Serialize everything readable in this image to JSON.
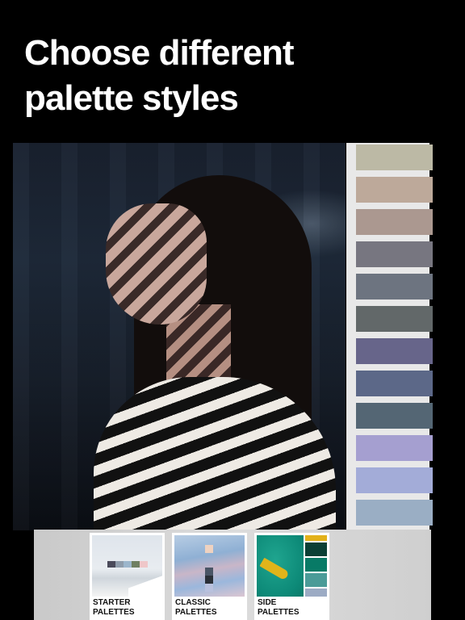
{
  "headline": {
    "line1": "Choose different",
    "line2": "palette styles"
  },
  "photo": {
    "description": "Woman in profile with striped shadows, striped sweater"
  },
  "palette": {
    "swatches": [
      {
        "name": "swatch-1",
        "color": "#bcb9a5"
      },
      {
        "name": "swatch-2",
        "color": "#bda99a"
      },
      {
        "name": "swatch-3",
        "color": "#ab9890"
      },
      {
        "name": "swatch-4",
        "color": "#777680"
      },
      {
        "name": "swatch-5",
        "color": "#6d7480"
      },
      {
        "name": "swatch-6",
        "color": "#626869"
      },
      {
        "name": "swatch-7",
        "color": "#67658a"
      },
      {
        "name": "swatch-8",
        "color": "#5c6888"
      },
      {
        "name": "swatch-9",
        "color": "#546674"
      },
      {
        "name": "swatch-10",
        "color": "#a59fd0"
      },
      {
        "name": "swatch-11",
        "color": "#a3acd8"
      },
      {
        "name": "swatch-12",
        "color": "#9aaec4"
      }
    ]
  },
  "styles": [
    {
      "id": "starter",
      "line1": "Starter",
      "line2": "Palettes",
      "colors": [
        "#4a4a5a",
        "#8f9cab",
        "#9cb6cc",
        "#6f7f62",
        "#efc7c9"
      ]
    },
    {
      "id": "classic",
      "line1": "Classic",
      "line2": "Palettes",
      "colors": [
        "#efd2c0",
        "#4a5566",
        "#2a2f38",
        "#b9c1de"
      ]
    },
    {
      "id": "side",
      "line1": "Side",
      "line2": "Palettes",
      "colors": [
        "#e3b11a",
        "#0b3f35",
        "#087a66",
        "#4b9b98",
        "#9cabc4"
      ]
    }
  ]
}
